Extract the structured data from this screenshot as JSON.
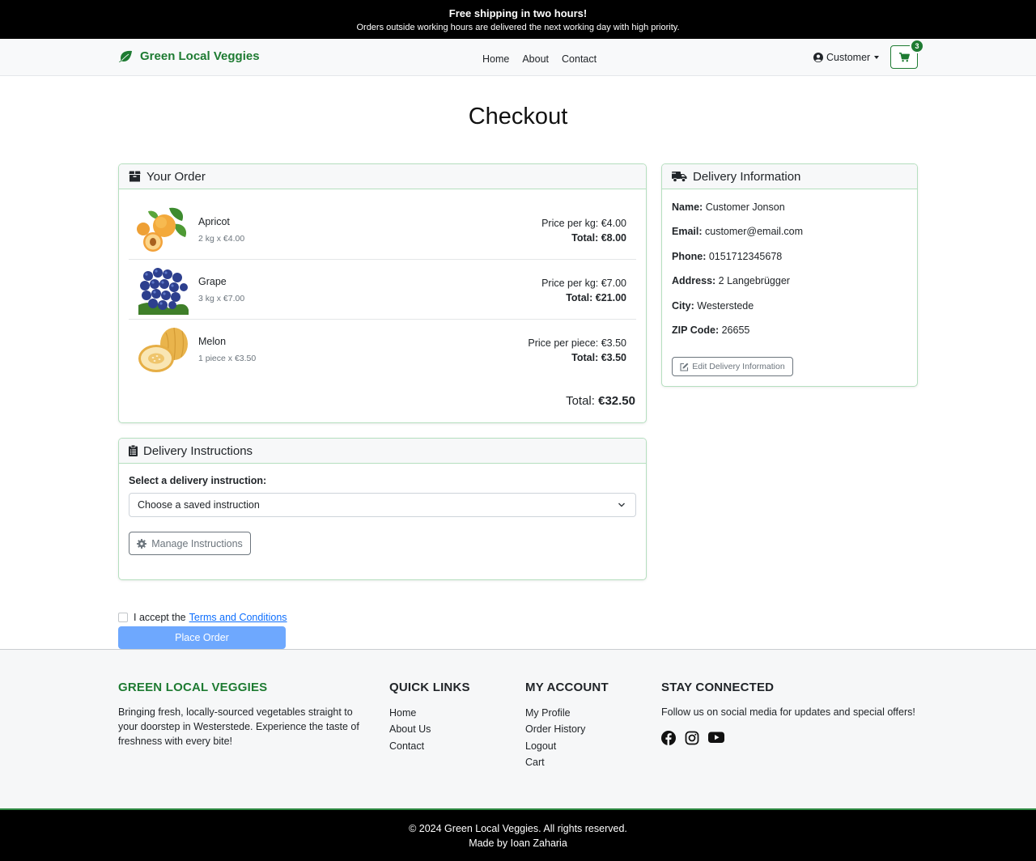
{
  "banner": {
    "headline": "Free shipping in two hours!",
    "subline": "Orders outside working hours are delivered the next working day with high priority."
  },
  "navbar": {
    "brand": "Green Local Veggies",
    "links": [
      "Home",
      "About",
      "Contact"
    ],
    "user_menu": "Customer",
    "cart_count": "3",
    "accent_color": "#1e7b32"
  },
  "page_title": "Checkout",
  "order": {
    "header": "Your Order",
    "items": [
      {
        "name": "Apricot",
        "qty": "2 kg x €4.00",
        "price": "Price per kg: €4.00",
        "total": "Total: €8.00",
        "image": "apricot-image"
      },
      {
        "name": "Grape",
        "qty": "3 kg x €7.00",
        "price": "Price per kg: €7.00",
        "total": "Total: €21.00",
        "image": "grape-image"
      },
      {
        "name": "Melon",
        "qty": "1 piece x €3.50",
        "price": "Price per piece: €3.50",
        "total": "Total: €3.50",
        "image": "melon-image"
      }
    ],
    "grand_total_label": "Total:",
    "grand_total_value": "€32.50"
  },
  "delivery": {
    "header": "Delivery Information",
    "rows": [
      {
        "label": "Name:",
        "value": "Customer Jonson"
      },
      {
        "label": "Email:",
        "value": "customer@email.com"
      },
      {
        "label": "Phone:",
        "value": "0151712345678"
      },
      {
        "label": "Address:",
        "value": "2 Langebrügger"
      },
      {
        "label": "City:",
        "value": "Westerstede"
      },
      {
        "label": "ZIP Code:",
        "value": "26655"
      }
    ],
    "edit_button": "Edit Delivery Information"
  },
  "instructions": {
    "header": "Delivery Instructions",
    "label": "Select a delivery instruction:",
    "select_value": "Choose a saved instruction",
    "manage_button": "Manage Instructions"
  },
  "terms": {
    "prefix": "I accept the",
    "link": "Terms and Conditions"
  },
  "place_order": "Place Order",
  "footer": {
    "brand_title": "GREEN LOCAL VEGGIES",
    "brand_text": "Bringing fresh, locally-sourced vegetables straight to your doorstep in Westerstede. Experience the taste of freshness with every bite!",
    "quick_links_title": "QUICK LINKS",
    "quick_links": [
      "Home",
      "About Us",
      "Contact"
    ],
    "account_title": "MY ACCOUNT",
    "account_links": [
      "My Profile",
      "Order History",
      "Logout",
      "Cart"
    ],
    "connect_title": "STAY CONNECTED",
    "connect_text": "Follow us on social media for updates and special offers!",
    "social_icons": [
      "facebook-icon",
      "instagram-icon",
      "youtube-icon"
    ],
    "copyright": "© 2024 Green Local Veggies. All rights reserved.",
    "made_by": "Made by Ioan Zaharia"
  }
}
